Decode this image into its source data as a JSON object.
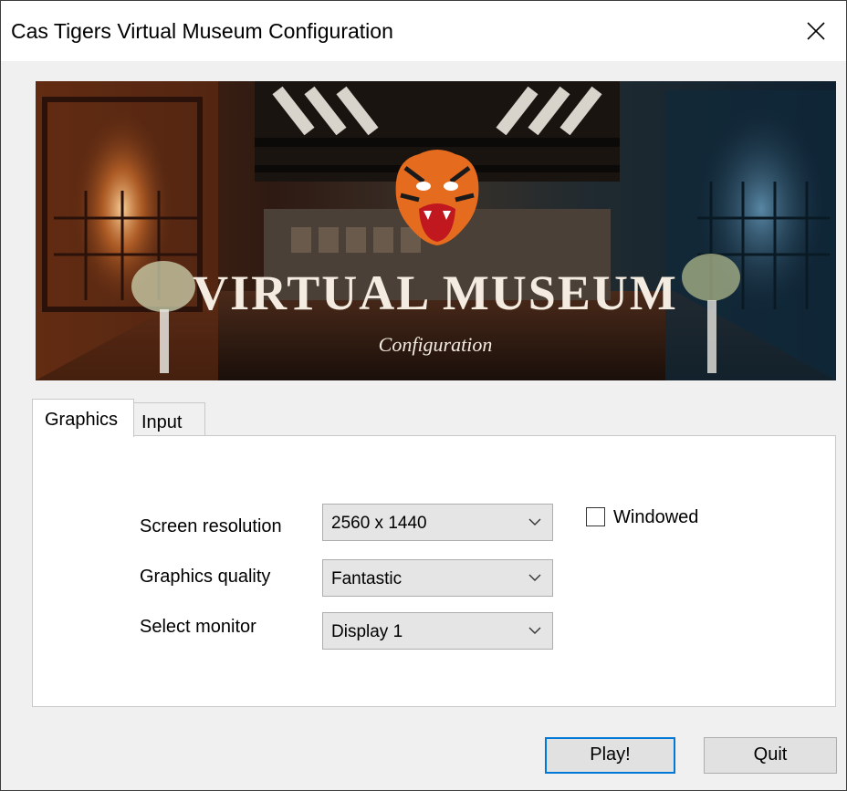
{
  "window": {
    "title": "Cas Tigers Virtual Museum Configuration"
  },
  "banner": {
    "heading": "VIRTUAL MUSEUM",
    "subheading": "Configuration"
  },
  "tabs": [
    {
      "label": "Graphics",
      "active": true
    },
    {
      "label": "Input",
      "active": false
    }
  ],
  "graphics": {
    "screen_resolution": {
      "label": "Screen resolution",
      "value": "2560 x 1440"
    },
    "graphics_quality": {
      "label": "Graphics quality",
      "value": "Fantastic"
    },
    "select_monitor": {
      "label": "Select monitor",
      "value": "Display 1"
    },
    "windowed": {
      "label": "Windowed",
      "checked": false
    }
  },
  "buttons": {
    "play": "Play!",
    "quit": "Quit"
  },
  "colors": {
    "focus_border": "#0078d7",
    "button_bg": "#e1e1e1",
    "window_bg": "#f0f0f0"
  }
}
